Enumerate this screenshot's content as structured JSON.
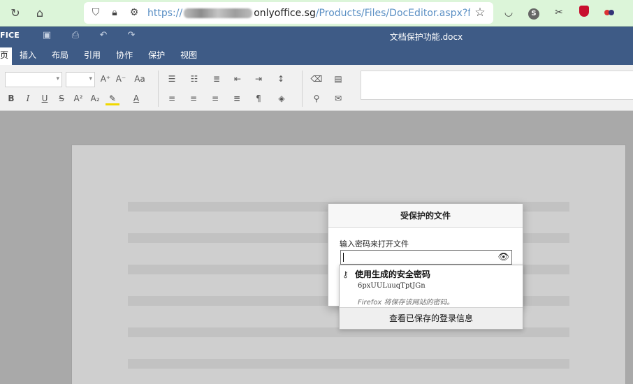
{
  "browser": {
    "url_prefix": "https://",
    "url_host": "onlyoffice.sg",
    "url_path": "/Products/Files/DocEditor.aspx?fileid",
    "profile_letter": "S"
  },
  "editor": {
    "brand": "FICE",
    "doc_title": "文档保护功能.docx",
    "tabs": [
      "页",
      "插入",
      "布局",
      "引用",
      "协作",
      "保护",
      "视图"
    ]
  },
  "toolbar": {
    "font_inc": "A⁺",
    "font_dec": "A⁻",
    "case": "Aa",
    "bold": "B",
    "italic": "I",
    "underline": "U",
    "strike": "S",
    "superscript": "A²",
    "subscript": "A₂",
    "font_color": "A",
    "paragraph_mark": "¶"
  },
  "dialog": {
    "title": "受保护的文件",
    "label": "输入密码来打开文件",
    "password_value": ""
  },
  "password_suggestion": {
    "title": "使用生成的安全密码",
    "generated_password": "6pxUULuuqTptJGn",
    "note": "Firefox 将保存该网站的密码。",
    "footer": "查看已保存的登录信息"
  }
}
